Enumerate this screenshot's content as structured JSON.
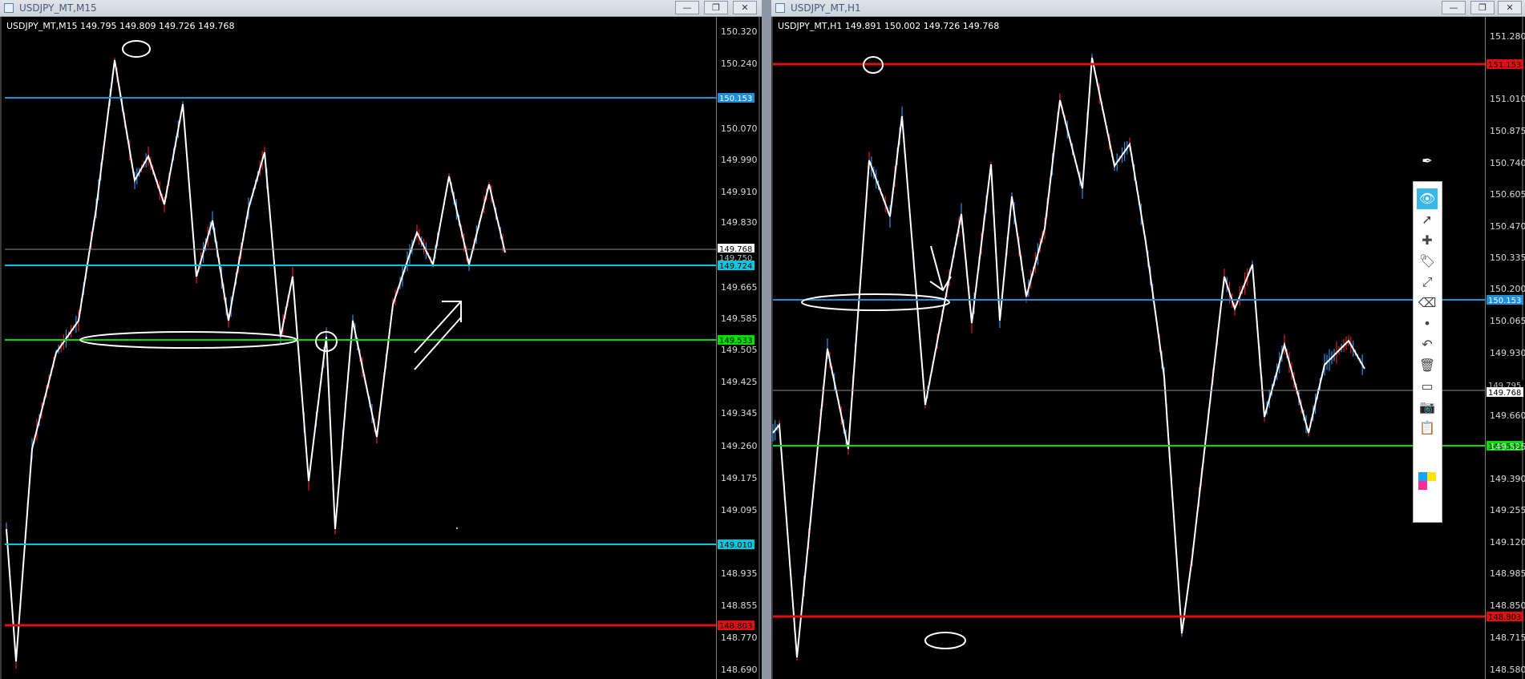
{
  "left": {
    "window_title": "USDJPY_MT,M15",
    "header": "USDJPY_MT,M15  149.795 149.809 149.726 149.768",
    "scale": [
      "150.320",
      "150.240",
      "150.070",
      "149.990",
      "149.910",
      "149.830",
      "149.665",
      "149.585",
      "149.505",
      "149.425",
      "149.345",
      "149.260",
      "149.175",
      "149.095",
      "148.935",
      "148.855",
      "148.770",
      "148.690"
    ],
    "price_tags": {
      "blue": "150.153",
      "current": "149.768",
      "grey": "149.750",
      "cyan1": "149.724",
      "green": "149.533",
      "cyan2": "149.010",
      "red": "148.803"
    },
    "colors": {
      "blue": "#1c8fd8",
      "cyan": "#00c8e0",
      "green": "#00dd00",
      "red": "#e01010"
    }
  },
  "right": {
    "window_title": "USDJPY_MT,H1",
    "header": "USDJPY_MT,H1  149.891 150.002 149.726 149.768",
    "scale": [
      "151.280",
      "151.010",
      "150.875",
      "150.740",
      "150.605",
      "150.470",
      "150.335",
      "150.200",
      "150.065",
      "149.930",
      "149.660",
      "149.525",
      "149.390",
      "149.255",
      "149.120",
      "148.985",
      "148.850",
      "148.715",
      "148.580"
    ],
    "price_tags": {
      "red_top": "151.153",
      "blue": "150.153",
      "grey": "149.795",
      "current": "149.768",
      "green": "149.533",
      "red_bottom": "148.803"
    }
  },
  "window_buttons": [
    "—",
    "❐",
    "✕"
  ],
  "toolbar": {
    "icons": [
      "pen-icon",
      "eye-icon",
      "cursor-icon",
      "crosshair-icon",
      "tag-icon",
      "ruler-icon",
      "eraser-icon",
      "dot-icon",
      "undo-icon",
      "trash-icon",
      "easel-icon",
      "camera-icon",
      "clipboard-icon",
      "palette-icon"
    ],
    "glyphs": [
      "✒",
      "👁",
      "➚",
      "✚",
      "🏷",
      "⤢",
      "⌫",
      "•",
      "↶",
      "🗑",
      "▭",
      "📷",
      "📋",
      ""
    ]
  }
}
